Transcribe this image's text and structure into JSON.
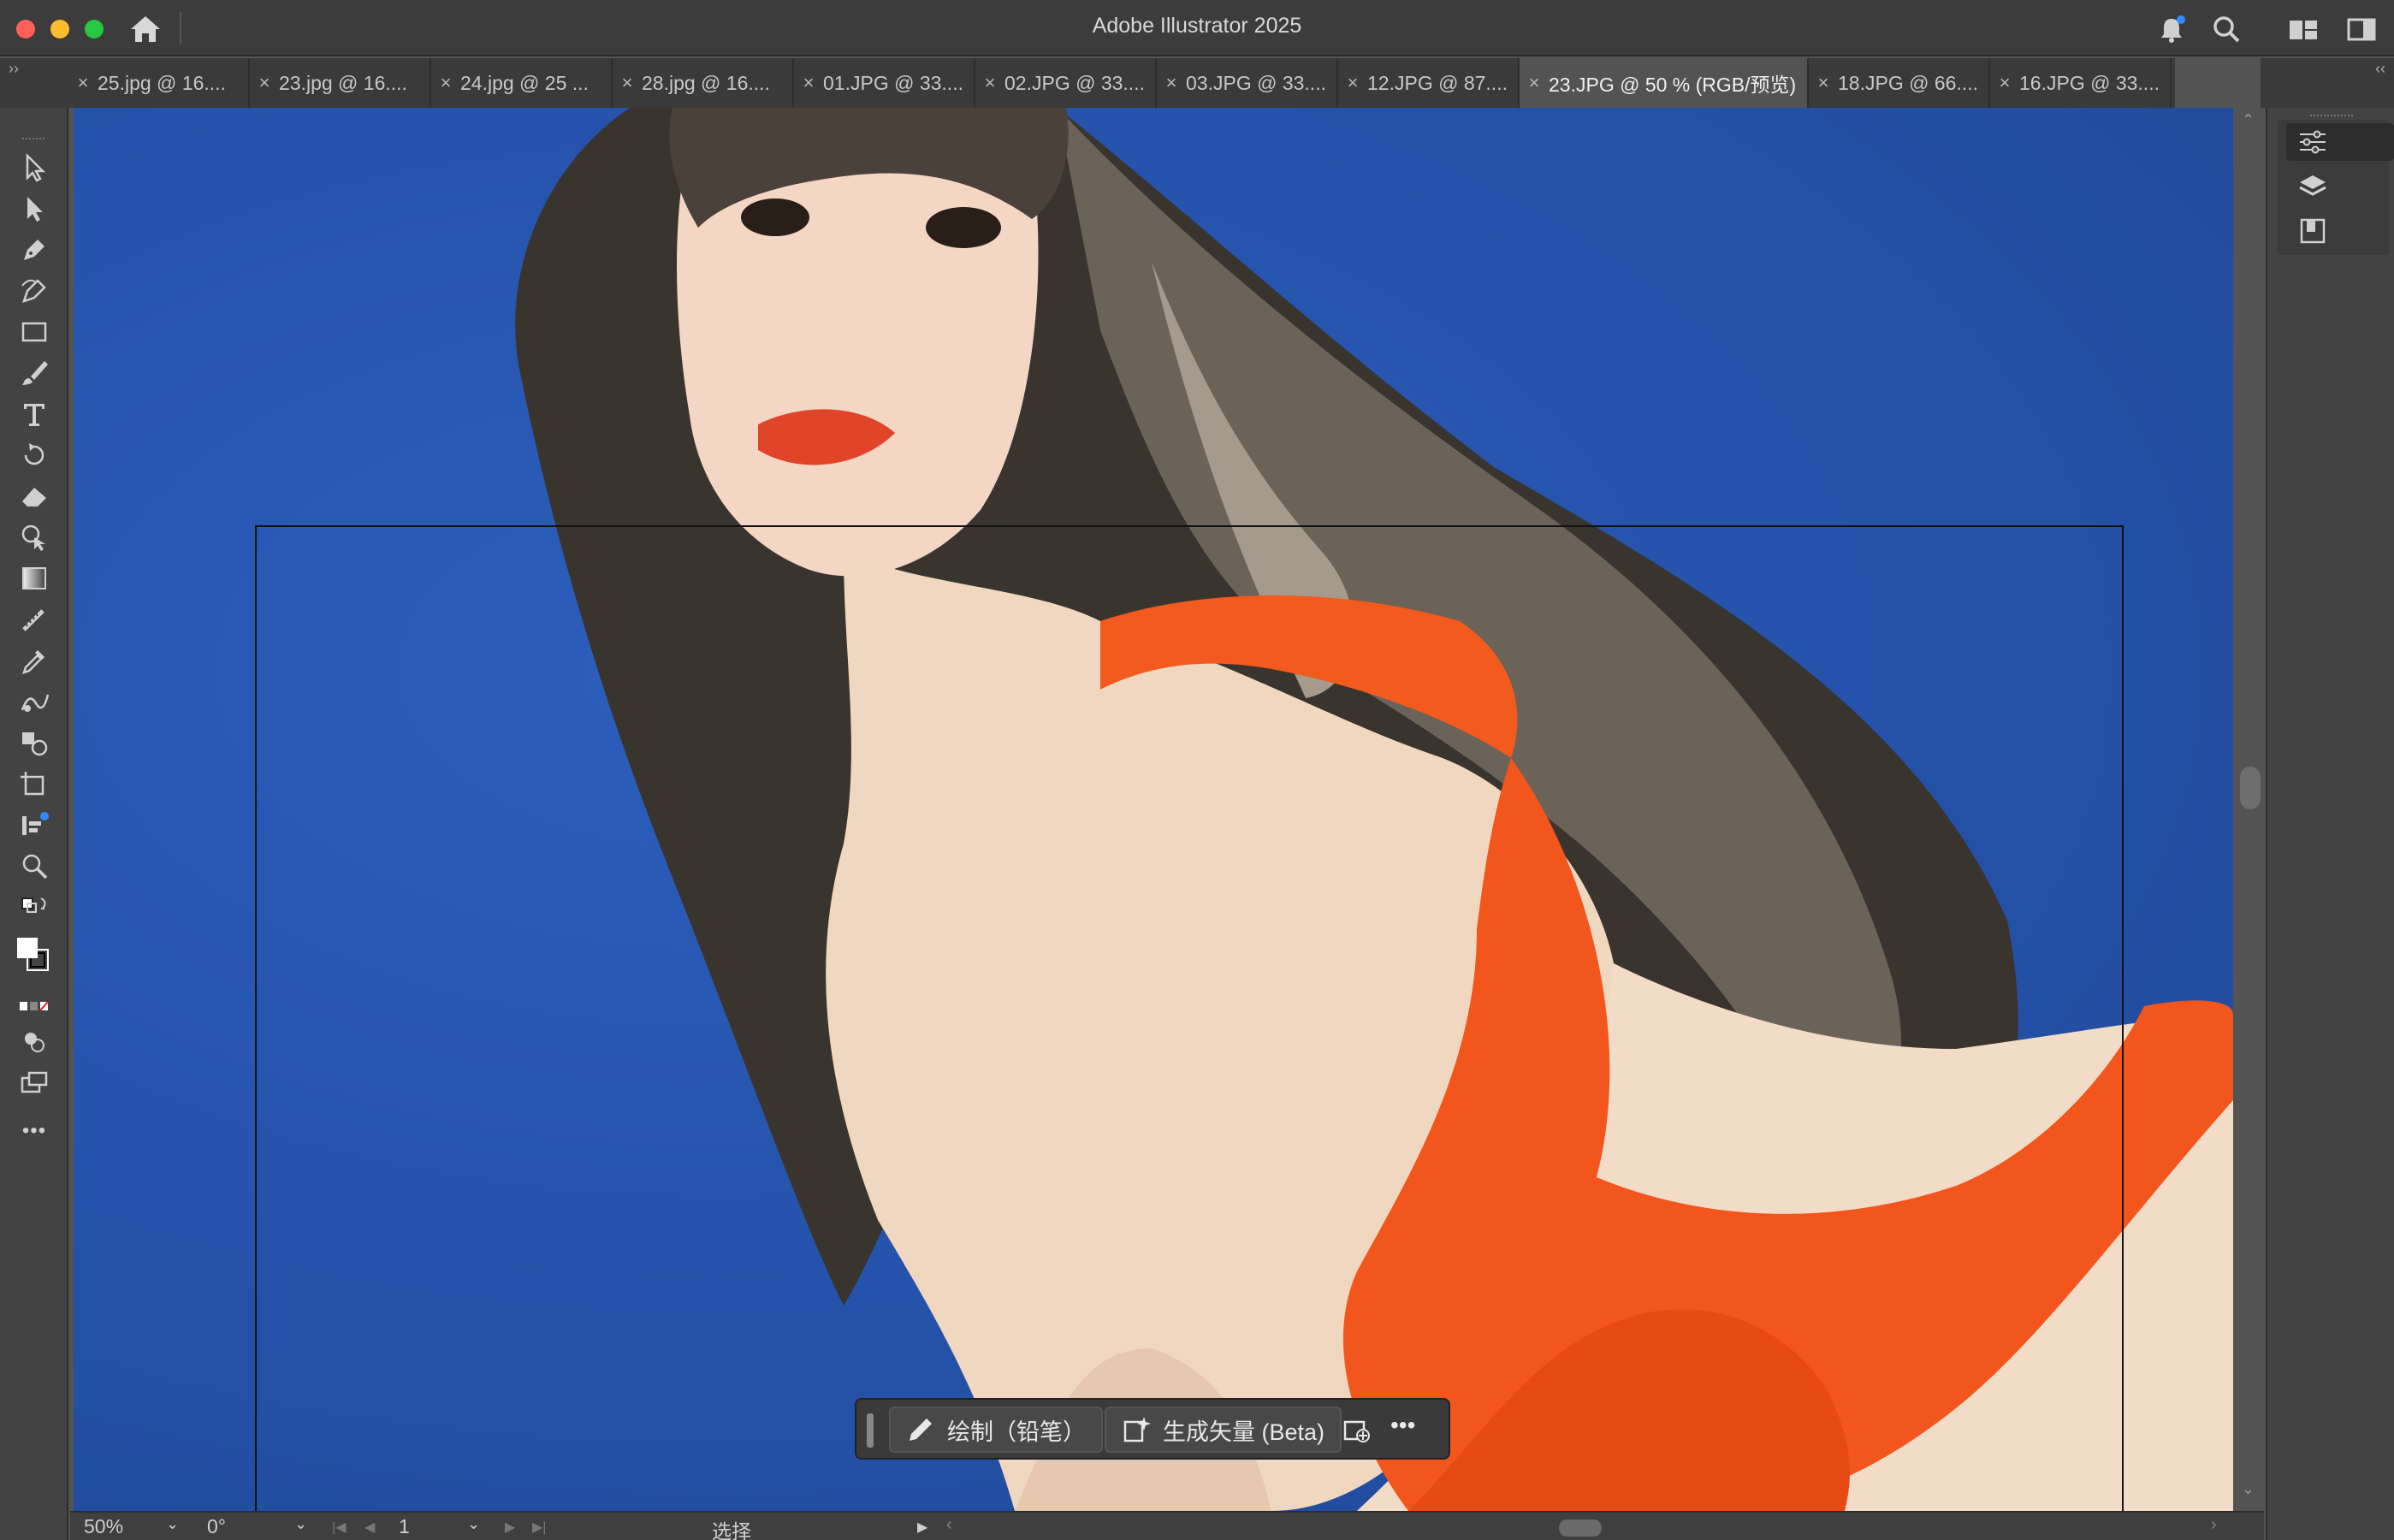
{
  "window": {
    "title": "Adobe Illustrator 2025"
  },
  "tabs": [
    {
      "label": "25.jpg @ 16...."
    },
    {
      "label": "23.jpg @ 16...."
    },
    {
      "label": "24.jpg @ 25 ..."
    },
    {
      "label": "28.jpg @ 16...."
    },
    {
      "label": "01.JPG @ 33...."
    },
    {
      "label": "02.JPG @ 33...."
    },
    {
      "label": "03.JPG @ 33...."
    },
    {
      "label": "12.JPG @ 87...."
    },
    {
      "label": "23.JPG @ 50 % (RGB/预览)",
      "active": true
    },
    {
      "label": "18.JPG @ 66...."
    },
    {
      "label": "16.JPG @ 33...."
    }
  ],
  "tab_close_glyph": "×",
  "toolbar": {
    "more_label": "•••"
  },
  "task_bar": {
    "draw_label": "绘制（铅笔）",
    "generate_label": "生成矢量 (Beta)",
    "more_label": "•••"
  },
  "status_bar": {
    "zoom": "50%",
    "rotation": "0°",
    "artboard_number": "1",
    "mode_text": "选择"
  },
  "colors": {
    "accent_notification": "#2f8bff",
    "canvas_background": "#2654ad",
    "ui_dark": "#3c3c3c"
  }
}
